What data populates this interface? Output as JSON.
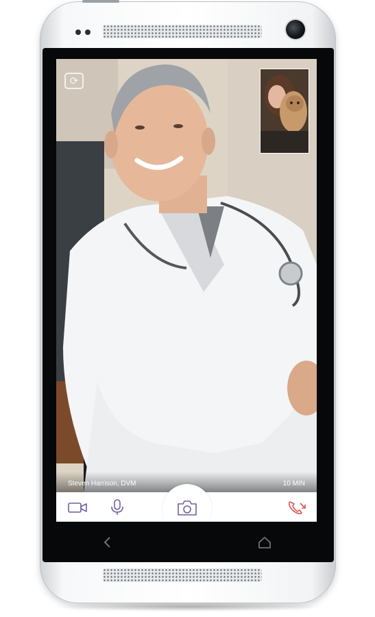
{
  "call": {
    "caller_name": "Steven Harrison, DVM",
    "duration": "10 MIN"
  },
  "controls": {
    "video_icon": "video-camera-icon",
    "mic_icon": "microphone-icon",
    "snapshot_icon": "camera-icon",
    "end_call_icon": "phone-hangup-icon",
    "switch_camera_icon": "switch-camera-icon"
  },
  "nav": {
    "back_icon": "back-arrow-icon",
    "home_icon": "home-icon"
  },
  "colors": {
    "icon_accent": "#6f5f9e",
    "end_call": "#d9534f"
  }
}
